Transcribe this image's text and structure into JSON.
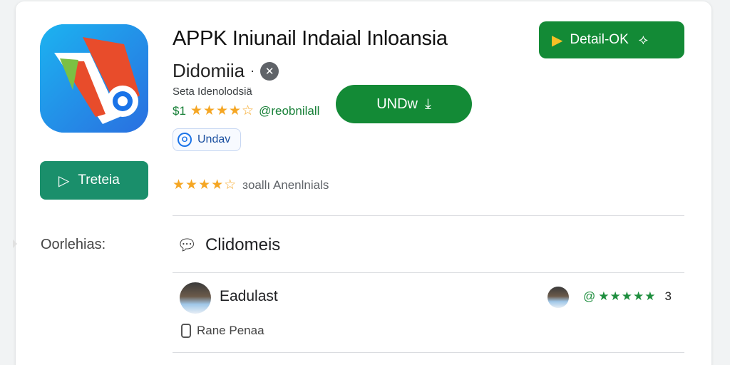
{
  "app": {
    "title": "APPK Iniunail Indaial Inloansia",
    "subtitle": "Didomiia",
    "subtitle_sep": "·",
    "developer": "Seta Idenolodsiä",
    "price": "$1",
    "rating_stars": "★★★★☆",
    "rating_value": 4.5,
    "rating_handle": "@reobnilall",
    "badge_label": "Undav",
    "icon": "app-logo-icon"
  },
  "buttons": {
    "open_label": "Treteia",
    "install_label": "UNDw",
    "detail_label": "Detail-OK"
  },
  "reviews": {
    "stars": "★★★★☆",
    "summary_label": "ɜoallı Anenlnials"
  },
  "section": {
    "side_label": "Oorlehias:",
    "comments_title": "Clidomeis"
  },
  "review_row": {
    "reviewer_name": "Eadulast",
    "stars_prefix": "@",
    "stars": "★★★★★",
    "count": "3",
    "meta_label": "Rane Penaa"
  },
  "colors": {
    "primary_green": "#138a36",
    "open_green": "#1a8f6b",
    "star_orange": "#f5a623",
    "star_green": "#1e8e3e"
  }
}
